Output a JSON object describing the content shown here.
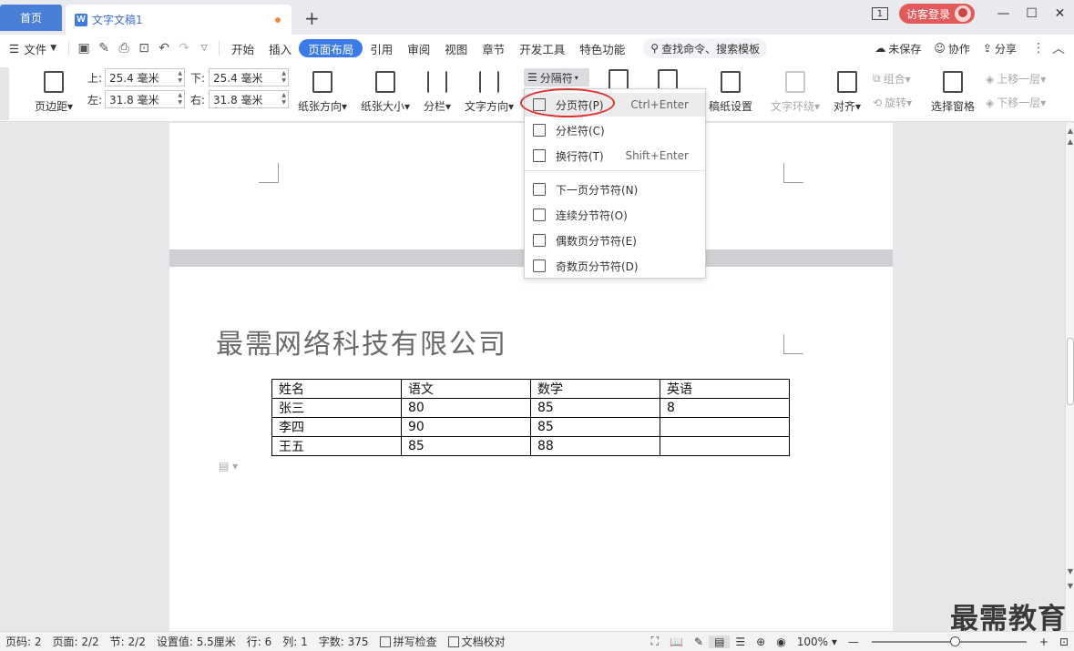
{
  "titlebar": {
    "home_tab": "首页",
    "doc_tab": "文字文稿1",
    "doc_icon": "W",
    "new_tab": "+",
    "page_indicator": "1",
    "login_label": "访客登录",
    "minimize": "—",
    "maximize": "☐",
    "close": "✕"
  },
  "menubar": {
    "file": "文件",
    "tabs": [
      "开始",
      "插入",
      "页面布局",
      "引用",
      "审阅",
      "视图",
      "章节",
      "开发工具",
      "特色功能"
    ],
    "active_tab": "页面布局",
    "search": "查找命令、搜索模板",
    "unsaved": "未保存",
    "collab": "协作",
    "share": "分享"
  },
  "ribbon": {
    "margins": "页边距",
    "top_label": "上:",
    "top_value": "25.4 毫米",
    "bottom_label": "下:",
    "bottom_value": "25.4 毫米",
    "left_label": "左:",
    "left_value": "31.8 毫米",
    "right_label": "右:",
    "right_value": "31.8 毫米",
    "orientation": "纸张方向",
    "size": "纸张大小",
    "columns": "分栏",
    "text_direction": "文字方向",
    "breaks": "分隔符",
    "manuscript": "稿纸设置",
    "text_wrap": "文字环绕",
    "align": "对齐",
    "group": "组合",
    "rotate": "旋转",
    "select_pane": "选择窗格",
    "bring_forward": "上移一层",
    "send_backward": "下移一层"
  },
  "dropdown": {
    "items": [
      {
        "label": "分页符(P)",
        "shortcut": "Ctrl+Enter"
      },
      {
        "label": "分栏符(C)",
        "shortcut": ""
      },
      {
        "label": "换行符(T)",
        "shortcut": "Shift+Enter"
      },
      {
        "label": "下一页分节符(N)",
        "shortcut": ""
      },
      {
        "label": "连续分节符(O)",
        "shortcut": ""
      },
      {
        "label": "偶数页分节符(E)",
        "shortcut": ""
      },
      {
        "label": "奇数页分节符(D)",
        "shortcut": ""
      }
    ]
  },
  "document": {
    "title": "最需网络科技有限公司",
    "table": {
      "header": [
        "姓名",
        "语文",
        "数学",
        "英语"
      ],
      "rows": [
        [
          "张三",
          "80",
          "85",
          "8"
        ],
        [
          "李四",
          "90",
          "85",
          ""
        ],
        [
          "王五",
          "85",
          "88",
          ""
        ]
      ]
    }
  },
  "statusbar": {
    "page_num": "页码: 2",
    "pages": "页面: 2/2",
    "section": "节: 2/2",
    "setting": "设置值: 5.5厘米",
    "row": "行: 6",
    "col": "列: 1",
    "words": "字数: 375",
    "spell": "拼写检查",
    "proof": "文档校对",
    "zoom": "100%",
    "zoom_minus": "—",
    "zoom_plus": "+"
  },
  "watermark": "最需教育"
}
